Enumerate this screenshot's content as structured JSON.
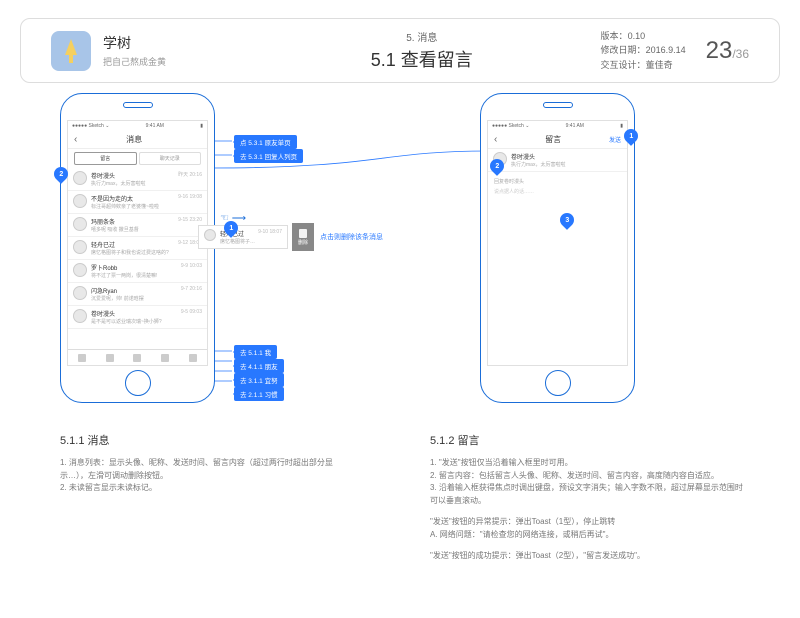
{
  "header": {
    "app_name": "学树",
    "app_slogan": "把自己熬成金黄",
    "section_no": "5. 消息",
    "section_title": "5.1 查看留言",
    "version_label": "版本：",
    "version": "0.10",
    "date_label": "修改日期：",
    "date": "2016.9.14",
    "designer_label": "交互设计：",
    "designer": "董佳奇",
    "page": "23",
    "page_total": "/36"
  },
  "statusbar": {
    "carrier": "Sketch",
    "signal": "●●●●●",
    "wifi": "⌄",
    "time": "9:41 AM",
    "bat": "▮"
  },
  "phone_left": {
    "nav_title": "消息",
    "nav_back": "‹",
    "seg_a": "留言",
    "seg_b": "聊天记录",
    "rows": [
      {
        "n": "卷时漫头",
        "t": "执行力max，太厉害啦啦",
        "tm": "昨天 20:16"
      },
      {
        "n": "不是因为走的太",
        "t": "标注哥超帅欸亲了老婆懂~啦啦",
        "tm": "9-16 19:08"
      },
      {
        "n": "玛丽条条",
        "t": "嘻多呢 吸收 撒旦基督",
        "tm": "9-15 23:20"
      },
      {
        "n": "轻舟已过",
        "t": "席忆格图将子和我也说过费这啥的?",
        "tm": "9-12 18:07"
      },
      {
        "n": "罗卜Robb",
        "t": "将不过了票一两岗，很清楚嘛!",
        "tm": "9-9 10:03"
      },
      {
        "n": "闪急Ryan",
        "t": "沉爱爱呢，帅! 前诺晗摆",
        "tm": "9-7 20:16"
      },
      {
        "n": "卷时漫头",
        "t": "是不是可以返业瑞次瑞~换小狮?",
        "tm": "9-5 09:03"
      }
    ]
  },
  "swipe": {
    "name": "轻舟已过",
    "text": "席忆格图将子和我也说过费这啥的?",
    "time": "9-10 18:07",
    "delete": "删除",
    "note": "点击则删除该条消息"
  },
  "phone_right": {
    "nav_title": "留言",
    "nav_back": "‹",
    "nav_action": "发送",
    "user": "卷时漫头",
    "user_sub": "执行力max，太厉害啦啦",
    "reply_label": "回复卷时漫头",
    "placeholder": "说点据人的话……"
  },
  "callouts": {
    "c1": "点 5.3.1 原友单页",
    "c2": "去 5.3.1 回复人列页",
    "b1": "去 5.1.1 我",
    "b2": "去 4.1.1 朋友",
    "b3": "去 3.1.1 宜努",
    "b4": "去 2.1.1 习惯"
  },
  "pins": {
    "p1": "1",
    "p2": "2",
    "p3": "1",
    "p4": "2",
    "p5": "3"
  },
  "desc_left": {
    "title": "5.1.1 消息",
    "lines": [
      "1. 消息列表：显示头像、昵称、发送时间、留言内容（超过两行时超出部分显示…），左滑可调动删除按钮。",
      "2. 未读留言显示未读标记。"
    ]
  },
  "desc_right": {
    "title": "5.1.2 留言",
    "lines": [
      "1. \"发送\"按钮仅当沿着输入框里时可用。",
      "2. 留言内容：包括留言人头像、昵称、发送时间、留言内容，高度随内容自适应。",
      "3. 沿着输入框获得焦点时调出键盘，预设文字消失；输入字数不限，超过屏幕显示范围时可以垂直滚动。",
      "",
      "\"发送\"按钮的异常提示：弹出Toast（1型），停止跳转",
      "A. 网络问题：\"请检查您的网络连接，或稍后再试\"。",
      "",
      "\"发送\"按钮的成功提示：弹出Toast（2型），\"留言发送成功\"。"
    ]
  }
}
